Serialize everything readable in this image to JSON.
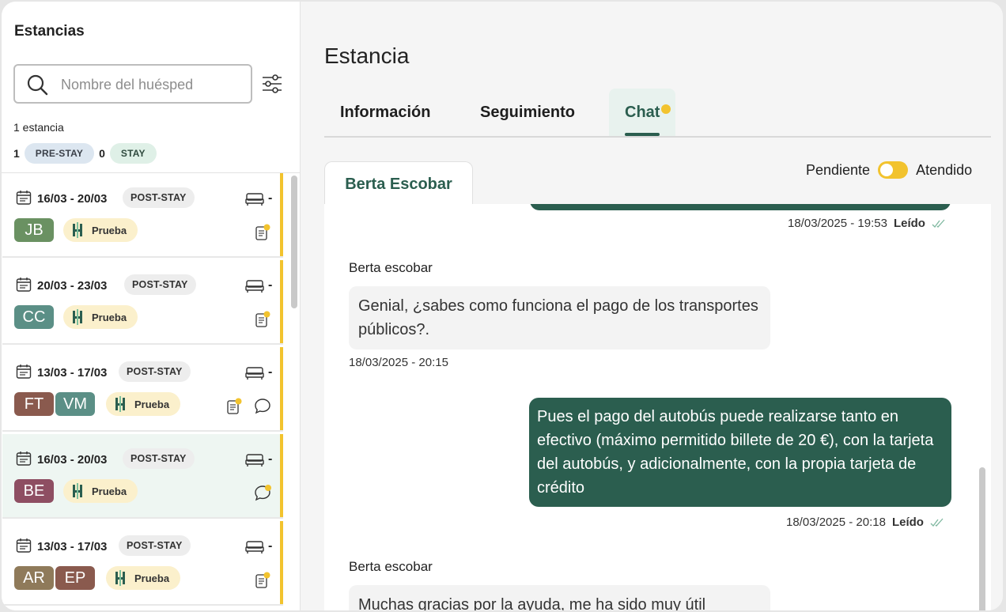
{
  "sidebar": {
    "title": "Estancias",
    "search_placeholder": "Nombre del huésped",
    "count_text": "1 estancia",
    "prestay_count": "1",
    "prestay_label": "PRE-STAY",
    "stay_count": "0",
    "stay_label": "STAY"
  },
  "stays": [
    {
      "dates": "16/03 - 20/03",
      "status": "POST-STAY",
      "room": "-",
      "tag": "Prueba",
      "guests": [
        {
          "initials": "JB",
          "color": "#6a9162"
        }
      ]
    },
    {
      "dates": "20/03 - 23/03",
      "status": "POST-STAY",
      "room": "-",
      "tag": "Prueba",
      "guests": [
        {
          "initials": "CC",
          "color": "#5b8f86"
        }
      ]
    },
    {
      "dates": "13/03 - 17/03",
      "status": "POST-STAY",
      "room": "-",
      "tag": "Prueba",
      "guests": [
        {
          "initials": "FT",
          "color": "#8a5a4e"
        },
        {
          "initials": "VM",
          "color": "#5b8f86"
        }
      ]
    },
    {
      "dates": "16/03 - 20/03",
      "status": "POST-STAY",
      "room": "-",
      "tag": "Prueba",
      "guests": [
        {
          "initials": "BE",
          "color": "#8e4e62"
        }
      ]
    },
    {
      "dates": "13/03 - 17/03",
      "status": "POST-STAY",
      "room": "-",
      "tag": "Prueba",
      "guests": [
        {
          "initials": "AR",
          "color": "#8f7a5a"
        },
        {
          "initials": "EP",
          "color": "#8a5a4e"
        }
      ]
    }
  ],
  "main": {
    "title": "Estancia",
    "tabs": [
      "Información",
      "Seguimiento",
      "Chat"
    ],
    "toggle_left": "Pendiente",
    "toggle_right": "Atendido",
    "conversation_tab": "Berta Escobar"
  },
  "messages": {
    "m0_time": "18/03/2025 - 19:53",
    "m0_read": "Leído",
    "m1_sender": "Berta escobar",
    "m1_text": "Genial, ¿sabes como funciona el pago de los transportes públicos?.",
    "m1_time": "18/03/2025 - 20:15",
    "m2_text": "Pues el pago del autobús puede realizarse tanto en efectivo (máximo permitido billete de 20 €), con la tarjeta del autobús, y adicionalmente, con la propia tarjeta de crédito",
    "m2_time": "18/03/2025 - 20:18",
    "m2_read": "Leído",
    "m3_sender": "Berta escobar",
    "m3_text": "Muchas gracias por la ayuda, me ha sido muy útil"
  },
  "colors": {
    "accent": "#2b5e4f",
    "highlight": "#f2c32e",
    "tag_bg": "#fbf0cc"
  }
}
